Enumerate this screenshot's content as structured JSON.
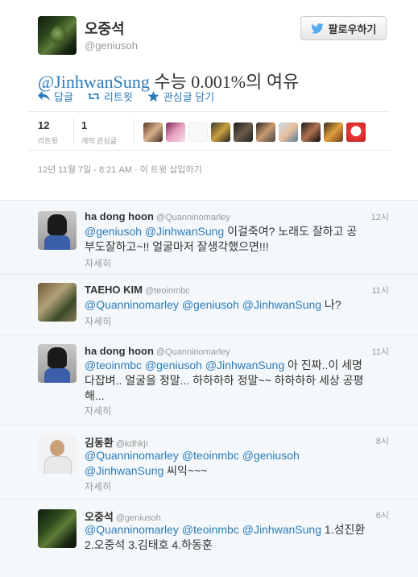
{
  "main": {
    "name": "오중석",
    "handle": "@geniusoh",
    "follow_label": "팔로우하기",
    "text_mention": "@JinhwanSung",
    "text_rest": " 수능 0.001%의 여유",
    "actions": {
      "reply": "답글",
      "retweet": "리트윗",
      "favorite": "관심글 담기"
    },
    "retweets": {
      "count": "12",
      "label": "리트윗"
    },
    "favorites": {
      "count": "1",
      "label": "개의 관심글"
    },
    "timestamp": "12년 11월 7일 - 8:21 AM · 이 트윗 삽입하기"
  },
  "colors": {
    "link": "#2b7bb9",
    "reply_bg": "#f5f8fa"
  },
  "replies": [
    {
      "name": "ha dong hoon",
      "handle": "@Quanninomarley",
      "time": "12시",
      "line1_mentions": "@geniusoh @JinhwanSung",
      "line1_rest": " 이걸죽여? 노래도 잘하고 공",
      "line2": "부도잘하고~!! 얼굴마저 잘생각했으면!!!",
      "more": "자세히"
    },
    {
      "name": "TAEHO KIM",
      "handle": "@teoinmbc",
      "time": "11시",
      "line1_mentions": "@Quanninomarley @geniusoh @JinhwanSung",
      "line1_rest": " 나?",
      "more": "자세히"
    },
    {
      "name": "ha dong hoon",
      "handle": "@Quanninomarley",
      "time": "11시",
      "line1_mentions": "@teoinmbc @geniusoh @JinhwanSung",
      "line1_rest": " 아 진짜..이 세명",
      "line2": "다잡벼.. 얼굴을 정말... 하하하하 정말~~ 하하하하 세상 공평",
      "line3": "해...",
      "more": "자세히"
    },
    {
      "name": "김동환",
      "handle": "@kdhkjr",
      "time": "8시",
      "line1_mentions": "@Quanninomarley @teoinmbc @geniusoh",
      "line2_mention": "@JinhwanSung",
      "line2_rest": " 씨익~~~",
      "more": "자세히"
    },
    {
      "name": "오중석",
      "handle": "@geniusoh",
      "time": "6시",
      "line1_mentions": "@Quanninomarley @teoinmbc @JinhwanSung",
      "line1_rest": " 1.성진환",
      "line2": "2.오중석 3.김태호 4.하동훈"
    }
  ]
}
